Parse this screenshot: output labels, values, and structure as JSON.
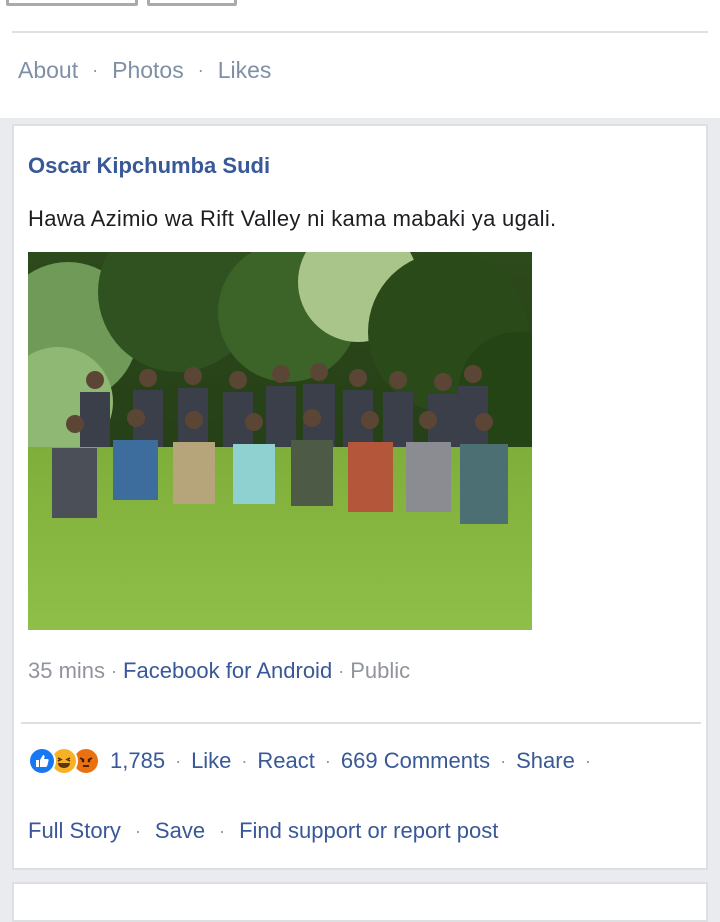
{
  "profile_nav": {
    "items": [
      "About",
      "Photos",
      "Likes"
    ],
    "separator": "·"
  },
  "post": {
    "author": "Oscar Kipchumba Sudi",
    "text": "Hawa Azimio wa Rift Valley ni kama mabaki ya ugali.",
    "time": "35 mins",
    "via": "Facebook for Android",
    "privacy": "Public",
    "reaction_count": "1,785",
    "reaction_icons": [
      "like-icon",
      "haha-icon",
      "angry-icon"
    ],
    "actions": {
      "like": "Like",
      "react": "React",
      "comments": "669 Comments",
      "share": "Share",
      "full_story": "Full Story",
      "save": "Save",
      "report": "Find support or report post"
    }
  },
  "colors": {
    "link": "#385898",
    "muted": "#90949c",
    "page_bg": "#e9ebee",
    "like": "#1877f2",
    "haha": "#f7b125",
    "angry": "#e9710f"
  }
}
